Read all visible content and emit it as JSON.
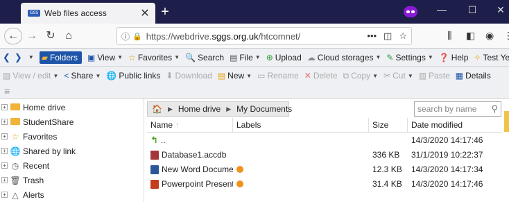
{
  "browser": {
    "tab_title": "Web files access",
    "tab_favicon_text": "GSS",
    "tab_close": "✕",
    "new_tab": "+",
    "win_min": "—",
    "win_max": "☐",
    "win_close": "✕",
    "url_prefix": "https://webdrive.",
    "url_domain": "sggs.org.uk",
    "url_suffix": "/htcomnet/",
    "url_more": "•••",
    "colors": {
      "tabbar": "#1d1f4a",
      "private": "#8c1bd8",
      "lock": "#1a9c33"
    }
  },
  "toolbar1": {
    "folders": "Folders",
    "view": "View",
    "favorites": "Favorites",
    "search": "Search",
    "file": "File",
    "upload": "Upload",
    "cloud": "Cloud storages",
    "settings": "Settings",
    "help": "Help",
    "test": "Test Year"
  },
  "toolbar2": {
    "view_edit": "View / edit",
    "share": "Share",
    "public_links": "Public links",
    "download": "Download",
    "new": "New",
    "rename": "Rename",
    "delete": "Delete",
    "copy": "Copy",
    "cut": "Cut",
    "paste": "Paste",
    "details": "Details"
  },
  "sidebar": {
    "items": [
      {
        "label": "Home drive",
        "icon": "folder-icon"
      },
      {
        "label": "StudentShare",
        "icon": "folder-icon"
      },
      {
        "label": "Favorites",
        "icon": "star-icon"
      },
      {
        "label": "Shared by link",
        "icon": "globe-icon"
      },
      {
        "label": "Recent",
        "icon": "clock-icon"
      },
      {
        "label": "Trash",
        "icon": "trash-icon"
      },
      {
        "label": "Alerts",
        "icon": "bell-icon"
      }
    ]
  },
  "main": {
    "breadcrumb": [
      "Home drive",
      "My Documents"
    ],
    "search_placeholder": "search by name",
    "columns": {
      "name": "Name",
      "labels": "Labels",
      "size": "Size",
      "date": "Date modified"
    },
    "rows": [
      {
        "name": "..",
        "size": "",
        "date": "14/3/2020 14:17:46",
        "type": "up",
        "label": false
      },
      {
        "name": "Database1.accdb",
        "size": "336 KB",
        "date": "31/1/2019 10:22:37",
        "type": "access",
        "label": false
      },
      {
        "name": "New Word Docume...",
        "size": "12.3 KB",
        "date": "14/3/2020 14:17:34",
        "type": "word",
        "label": true
      },
      {
        "name": "Powerpoint Present...",
        "size": "31.4 KB",
        "date": "14/3/2020 14:17:46",
        "type": "powerpoint",
        "label": true
      }
    ],
    "label_color": "#f0921e"
  }
}
